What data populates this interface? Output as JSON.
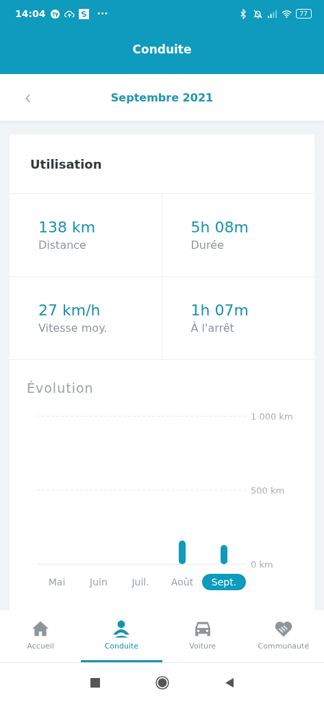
{
  "status_bar": {
    "time": "14:04",
    "more": "···",
    "battery": "77"
  },
  "header": {
    "title": "Conduite"
  },
  "month_bar": {
    "back": "‹",
    "title": "Septembre 2021"
  },
  "usage": {
    "title": "Utilisation",
    "stats": [
      {
        "value": "138 km",
        "label": "Distance"
      },
      {
        "value": "5h 08m",
        "label": "Durée"
      },
      {
        "value": "27 km/h",
        "label": "Vitesse moy."
      },
      {
        "value": "1h 07m",
        "label": "À l'arrêt"
      }
    ]
  },
  "evolution": {
    "title": "Évolution",
    "category_selected": [
      false,
      false,
      false,
      false,
      true
    ],
    "chart_data": {
      "type": "bar",
      "categories": [
        "Mai",
        "Juin",
        "Juil.",
        "Août",
        "Sept."
      ],
      "series": [
        {
          "color": "#0e9bbd",
          "values": [
            0,
            0,
            0,
            160,
            130
          ]
        }
      ],
      "ylim": [
        0,
        1000
      ],
      "yticks": [
        {
          "value": 0,
          "label": "0 km"
        },
        {
          "value": 500,
          "label": "500 km"
        },
        {
          "value": 1000,
          "label": "1 000 km"
        }
      ]
    }
  },
  "tab_bar": [
    {
      "label": "Accueil",
      "kind": "home",
      "selected": false
    },
    {
      "label": "Conduite",
      "kind": "driver",
      "selected": true
    },
    {
      "label": "Voiture",
      "kind": "car",
      "selected": false
    },
    {
      "label": "Communauté",
      "kind": "hands",
      "selected": false
    }
  ]
}
